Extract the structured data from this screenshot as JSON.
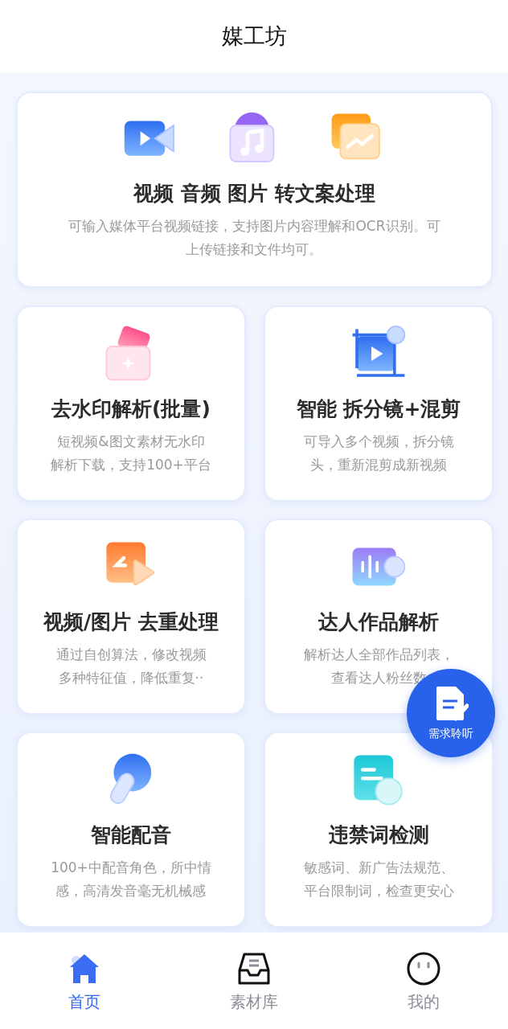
{
  "header": {
    "title": "媒工坊"
  },
  "hero_card": {
    "icons": [
      {
        "kind": "video"
      },
      {
        "kind": "audio"
      },
      {
        "kind": "image"
      }
    ],
    "title": "视频 音频 图片 转文案处理",
    "desc_lines": [
      "可输入媒体平台视频链接，支持图片内容理解和OCR识别。可",
      "上传链接和文件均可。"
    ]
  },
  "cards": [
    {
      "kind": "watermark",
      "title": "去水印解析(批量)",
      "desc_lines": [
        "短视频&图文素材无水印",
        "解析下载，支持100+平台"
      ]
    },
    {
      "kind": "crop",
      "title": "智能 拆分镜+混剪",
      "desc_lines": [
        "可导入多个视频，拆分镜",
        "头，重新混剪成新视频"
      ]
    },
    {
      "kind": "dedupe",
      "title": "视频/图片 去重处理",
      "desc_lines": [
        "通过自创算法，修改视频",
        "多种特征值，降低重复··"
      ]
    },
    {
      "kind": "wave",
      "title": "达人作品解析",
      "desc_lines": [
        "解析达人全部作品列表，",
        "查看达人粉丝数"
      ]
    },
    {
      "kind": "dubbing",
      "title": "智能配音",
      "desc_lines": [
        "100+中配音角色，所中情",
        "感，高清发音毫无机械感"
      ]
    },
    {
      "kind": "textcheck",
      "title": "违禁词检测",
      "desc_lines": [
        "敏感词、新广告法规范、",
        "平台限制词，检查更安心"
      ]
    }
  ],
  "fab": {
    "label": "需求聆听"
  },
  "tab_bar": [
    {
      "kind": "home",
      "label": "首页",
      "selected": true
    },
    {
      "kind": "inbox",
      "label": "素材库",
      "selected": false
    },
    {
      "kind": "face",
      "label": "我的",
      "selected": false
    }
  ]
}
